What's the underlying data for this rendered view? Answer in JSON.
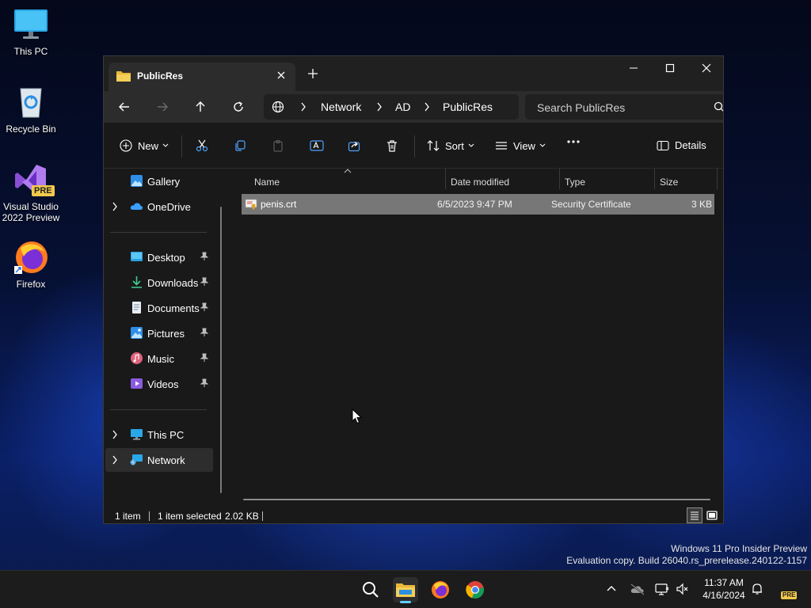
{
  "desktop": {
    "icons": [
      {
        "label_line1": "This PC",
        "label_line2": ""
      },
      {
        "label_line1": "Recycle Bin",
        "label_line2": ""
      },
      {
        "label_line1": "Visual Studio",
        "label_line2": "2022 Preview",
        "badge": "PRE"
      },
      {
        "label_line1": "Firefox",
        "label_line2": ""
      }
    ],
    "watermark": {
      "line1": "Windows 11 Pro Insider Preview",
      "line2": "Evaluation copy. Build 26040.rs_prerelease.240122-1157"
    }
  },
  "window": {
    "tab_title": "PublicRes",
    "breadcrumb": [
      "Network",
      "AD",
      "PublicRes"
    ],
    "search_placeholder": "Search PublicRes",
    "toolbar": {
      "new_label": "New",
      "sort_label": "Sort",
      "view_label": "View",
      "details_label": "Details"
    },
    "nav": {
      "items": [
        {
          "label": "Gallery"
        },
        {
          "label": "OneDrive"
        },
        {
          "label": "Desktop"
        },
        {
          "label": "Downloads"
        },
        {
          "label": "Documents"
        },
        {
          "label": "Pictures"
        },
        {
          "label": "Music"
        },
        {
          "label": "Videos"
        },
        {
          "label": "This PC"
        },
        {
          "label": "Network"
        }
      ]
    },
    "columns": {
      "name": "Name",
      "date": "Date modified",
      "type": "Type",
      "size": "Size"
    },
    "files": [
      {
        "name": "penis.crt",
        "date": "6/5/2023 9:47 PM",
        "type": "Security Certificate",
        "size": "3 KB"
      }
    ],
    "status": {
      "count": "1 item",
      "selected": "1 item selected",
      "size": "2.02 KB"
    }
  },
  "taskbar": {
    "time": "11:37 AM",
    "date": "4/16/2024",
    "badge": "PRE"
  },
  "colors": {
    "accent": "#60cdff",
    "selection": "#777777",
    "window_bg": "#191919"
  }
}
